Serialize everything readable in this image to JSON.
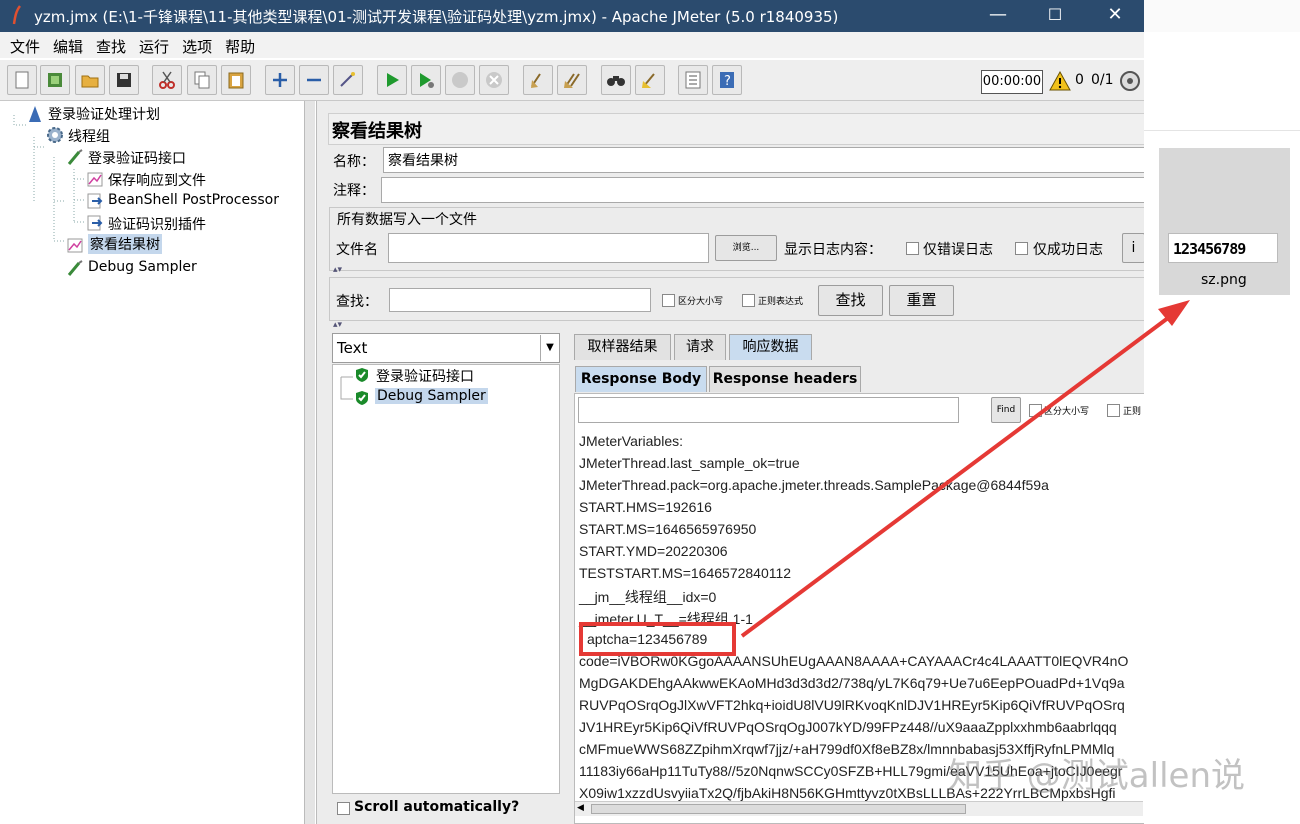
{
  "window": {
    "title": "yzm.jmx (E:\\1-千锋课程\\11-其他类型课程\\01-测试开发课程\\验证码处理\\yzm.jmx) - Apache JMeter (5.0 r1840935)",
    "minimize": "—",
    "maximize": "☐",
    "close": "✕"
  },
  "menu": [
    "文件",
    "编辑",
    "查找",
    "运行",
    "选项",
    "帮助"
  ],
  "toolbar": {
    "timer": "00:00:00",
    "warnings": "0",
    "threads": "0/1"
  },
  "tree": {
    "nodes": [
      "登录验证处理计划",
      "线程组",
      "登录验证码接口",
      "保存响应到文件",
      "BeanShell PostProcessor",
      "验证码识别插件",
      "察看结果树",
      "Debug Sampler"
    ]
  },
  "panel": {
    "title": "察看结果树",
    "name_label": "名称：",
    "name_value": "察看结果树",
    "comment_label": "注释：",
    "file_section": "所有数据写入一个文件",
    "filename_label": "文件名",
    "browse": "浏览...",
    "log_label": "显示日志内容：",
    "errors_only": "仅错误日志",
    "success_only": "仅成功日志",
    "search_label": "查找：",
    "case_sensitive": "区分大小写",
    "regex": "正则表达式",
    "search_button": "查找",
    "reset_button": "重置"
  },
  "results": {
    "renderer": "Text",
    "samples": [
      "登录验证码接口",
      "Debug Sampler"
    ],
    "scroll_auto": "Scroll automatically?"
  },
  "tabs": [
    "取样器结果",
    "请求",
    "响应数据"
  ],
  "subtabs": [
    "Response Body",
    "Response headers"
  ],
  "find": {
    "button": "Find",
    "case": "区分大小写",
    "regex": "正则"
  },
  "response_lines": [
    "JMeterVariables:",
    "JMeterThread.last_sample_ok=true",
    "JMeterThread.pack=org.apache.jmeter.threads.SamplePackage@6844f59a",
    "START.HMS=192616",
    "START.MS=1646565976950",
    "START.YMD=20220306",
    "TESTSTART.MS=1646572840112",
    "__jm__线程组__idx=0",
    "__jmeter.U_T__=线程组 1-1",
    "aptcha=123456789",
    "code=iVBORw0KGgoAAAANSUhEUgAAAN8AAAA+CAYAAACr4c4LAAATT0lEQVR4nO",
    "MgDGAKDEhgAAkwwEKAoMHd3d3d3d2/738q/yL7K6q79+Ue7u6EepPOuadPd+1Vq9a",
    "RUVPqOSrqOgJlXwVFT2hkq+ioidU8lVU9lRKvoqKnlDJV1HREyr5Kip6QiVfRUVPqOSrq",
    "JV1HREyr5Kip6QiVfRUVPqOSrqOgJ007kYD/99FPz448//uX9aaaZpplxxhmb6aabrlqqq",
    "cMFmueWWS68ZZpihmXrqwf7jjz/+aH799df0Xf8eBZ8x/lmnnbabasj53XffjRyfnLPMMlq",
    "11183iy66aHp11TuTy88//5z0NqnwSCCy0SFZB+HLL79gmi/eaVV15UhEoa+jtoCIJ0eegr",
    "X09iw1xzzdUsvyiiaTx2Q/fjbAkiH8N56KGHmttyvz0tXBsLLLBAs+222YrrLBCMpxbsHgfi"
  ],
  "thumbnail": {
    "digits": "123456789",
    "filename": "sz.png"
  },
  "watermark": "知乎 @测试allen说",
  "colors": {
    "titlebar": "#2b4b6e",
    "highlight": "#e53935",
    "selection": "#c4d7ec"
  }
}
